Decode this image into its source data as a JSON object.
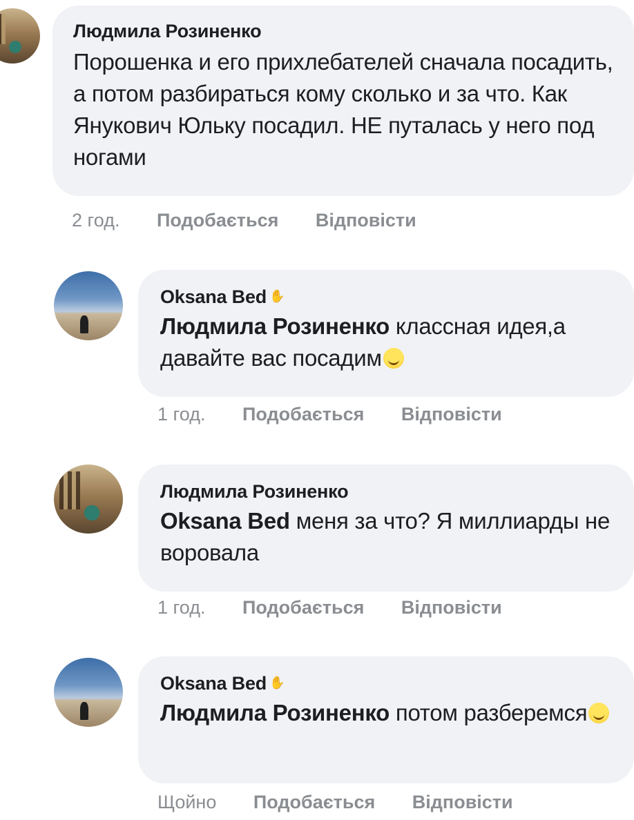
{
  "comments": [
    {
      "author": "Людмила Розиненко",
      "mention": "",
      "text": "Порошенка и его прихлебателей сначала посадить, а потом разбираться кому сколько и за что. Как Янукович Юльку посадил.  НЕ путалась у него под ногами",
      "time": "2 год.",
      "like": "Подобається",
      "reply": "Відповісти"
    },
    {
      "author": "Oksana Bed",
      "mention": "Людмила Розиненко",
      "text": "классная идея,а давайте вас посадим",
      "emoji": "winking-face-emoji",
      "time": "1 год.",
      "like": "Подобається",
      "reply": "Відповісти"
    },
    {
      "author": "Людмила Розиненко",
      "mention": "Oksana Bed",
      "text": "меня за что? Я миллиарды не воровала",
      "time": "1 год.",
      "like": "Подобається",
      "reply": "Відповісти"
    },
    {
      "author": "Oksana Bed",
      "mention": "Людмила Розиненко",
      "text": "потом разберемся",
      "emoji": "grinning-face-emoji",
      "time": "Щойно",
      "like": "Подобається",
      "reply": "Відповісти"
    }
  ]
}
